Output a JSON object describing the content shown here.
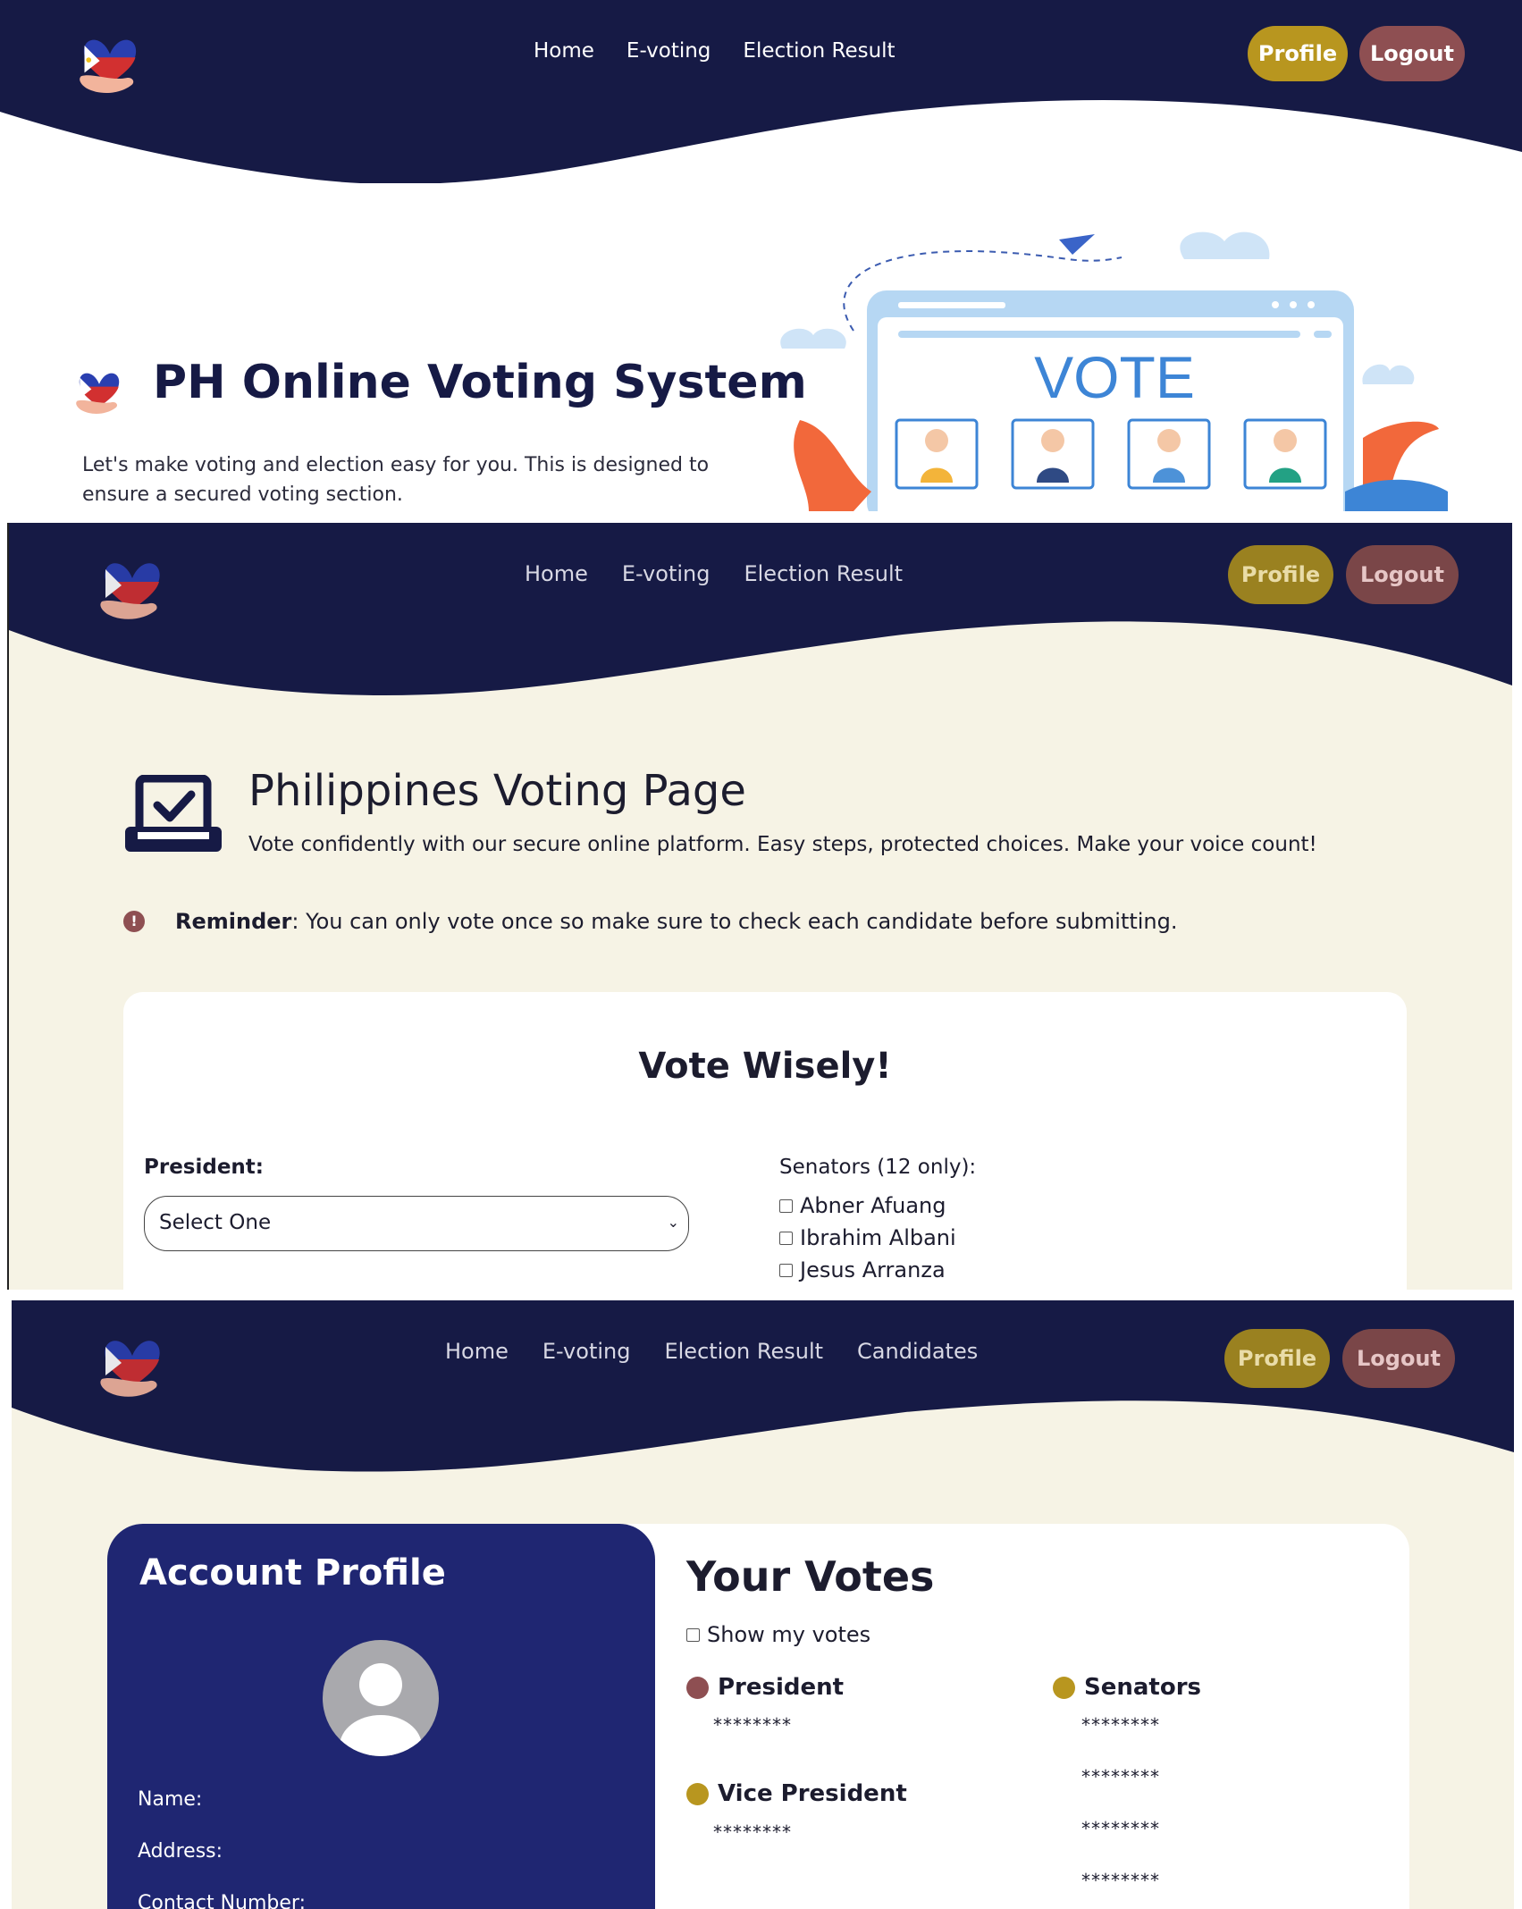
{
  "brand": {
    "logo": "heart-hand-flag-logo"
  },
  "colors": {
    "navy": "#161a45",
    "gold": "#b8961f",
    "rose": "#8e4f52",
    "cream": "#f6f3e5",
    "profile_card": "#1f2672"
  },
  "screen1": {
    "nav": [
      "Home",
      "E-voting",
      "Election Result"
    ],
    "profile_button": "Profile",
    "logout_button": "Logout",
    "hero_title": "PH Online Voting System",
    "hero_desc": "Let's make voting and election easy for you. This is designed to ensure a secured voting section.",
    "illustration_text": "VOTE"
  },
  "screen2": {
    "nav": [
      "Home",
      "E-voting",
      "Election Result"
    ],
    "profile_button": "Profile",
    "logout_button": "Logout",
    "page_title": "Philippines Voting Page",
    "page_subtitle": "Vote confidently with our secure online platform. Easy steps, protected choices. Make your voice count!",
    "reminder_label": "Reminder",
    "reminder_text": ": You can only vote once so make sure to check each candidate before submitting.",
    "card_title": "Vote Wisely!",
    "president_label": "President:",
    "president_select": "Select One",
    "senators_label": "Senators (12 only):",
    "senators": [
      "Abner Afuang",
      "Ibrahim Albani",
      "Jesus Arranza"
    ]
  },
  "screen3": {
    "nav": [
      "Home",
      "E-voting",
      "Election Result",
      "Candidates"
    ],
    "profile_button": "Profile",
    "logout_button": "Logout",
    "account_title": "Account Profile",
    "fields": [
      "Name:",
      "Address:",
      "Contact Number:"
    ],
    "votes_title": "Your Votes",
    "show_votes_label": "Show my votes",
    "president_label": "President",
    "president_votes": [
      "********"
    ],
    "vice_president_label": "Vice President",
    "vice_president_votes": [
      "********"
    ],
    "senators_label": "Senators",
    "senators_votes": [
      "********",
      "********",
      "********",
      "********"
    ]
  }
}
